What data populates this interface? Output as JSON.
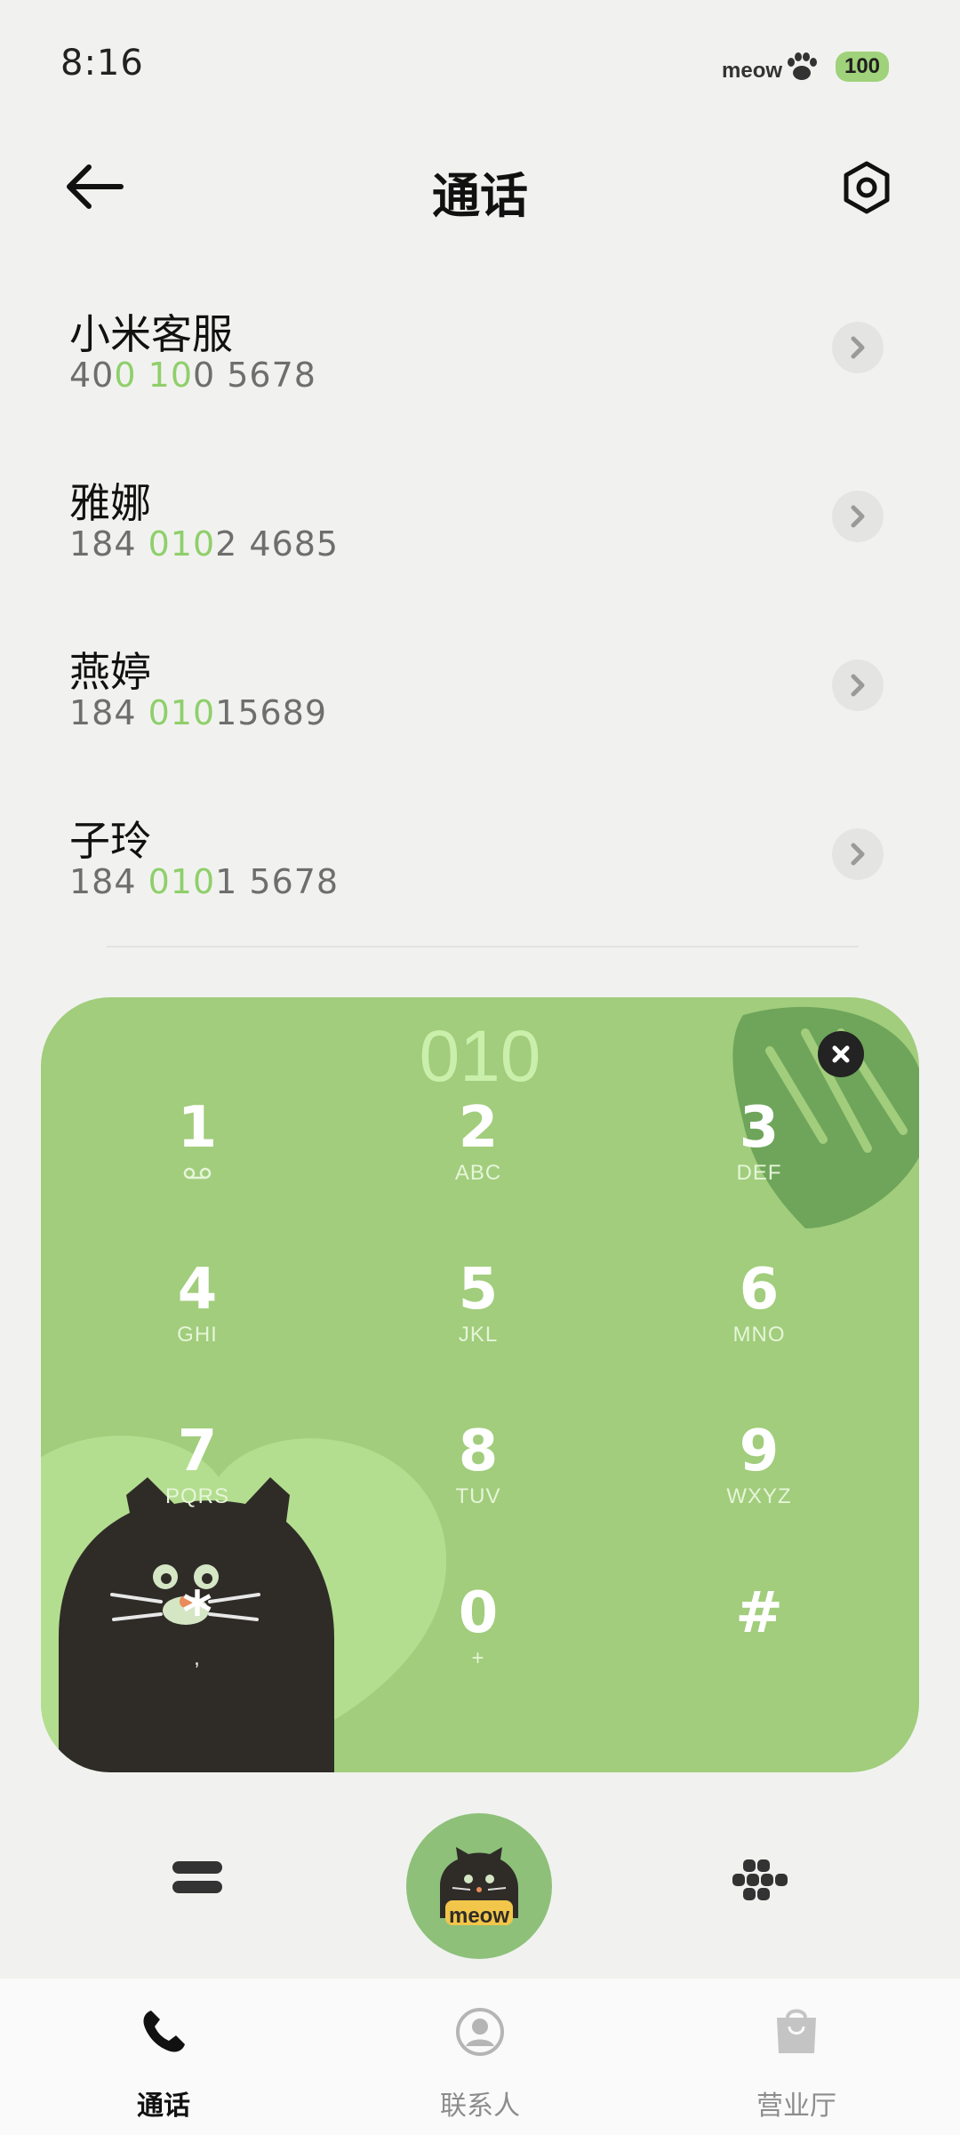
{
  "status_bar": {
    "time": "8:16",
    "brand": "meow",
    "battery": "100"
  },
  "header": {
    "title": "通话",
    "back_icon": "back-arrow-icon",
    "settings_icon": "settings-hexagon-icon"
  },
  "contacts": [
    {
      "name": "小米客服",
      "number_parts": [
        {
          "text": "40",
          "hl": false
        },
        {
          "text": "0",
          "hl": true
        },
        {
          "text": " ",
          "hl": false
        },
        {
          "text": "10",
          "hl": true
        },
        {
          "text": "0 5678",
          "hl": false
        }
      ]
    },
    {
      "name": "雅娜",
      "number_parts": [
        {
          "text": "184 ",
          "hl": false
        },
        {
          "text": "010",
          "hl": true
        },
        {
          "text": "2 4685",
          "hl": false
        }
      ]
    },
    {
      "name": "燕婷",
      "number_parts": [
        {
          "text": "184 ",
          "hl": false
        },
        {
          "text": "010",
          "hl": true
        },
        {
          "text": "15689",
          "hl": false
        }
      ]
    },
    {
      "name": "子玲",
      "number_parts": [
        {
          "text": "184 ",
          "hl": false
        },
        {
          "text": "010",
          "hl": true
        },
        {
          "text": "1 5678",
          "hl": false
        }
      ]
    }
  ],
  "dialer": {
    "input": "010",
    "keys": [
      {
        "digit": "1",
        "letters": "voicemail"
      },
      {
        "digit": "2",
        "letters": "ABC"
      },
      {
        "digit": "3",
        "letters": "DEF"
      },
      {
        "digit": "4",
        "letters": "GHI"
      },
      {
        "digit": "5",
        "letters": "JKL"
      },
      {
        "digit": "6",
        "letters": "MNO"
      },
      {
        "digit": "7",
        "letters": "PQRS"
      },
      {
        "digit": "8",
        "letters": "TUV"
      },
      {
        "digit": "9",
        "letters": "WXYZ"
      },
      {
        "digit": "*",
        "letters": ","
      },
      {
        "digit": "0",
        "letters": "+"
      },
      {
        "digit": "#",
        "letters": ""
      }
    ]
  },
  "call_button": {
    "label": "meow"
  },
  "tabs": [
    {
      "label": "通话",
      "icon": "phone-icon",
      "active": true
    },
    {
      "label": "联系人",
      "icon": "person-icon",
      "active": false
    },
    {
      "label": "营业厅",
      "icon": "shopping-bag-icon",
      "active": false
    }
  ],
  "colors": {
    "accent_green": "#a1cd7c",
    "highlight": "#8fcf6b",
    "background": "#f1f2ef"
  }
}
